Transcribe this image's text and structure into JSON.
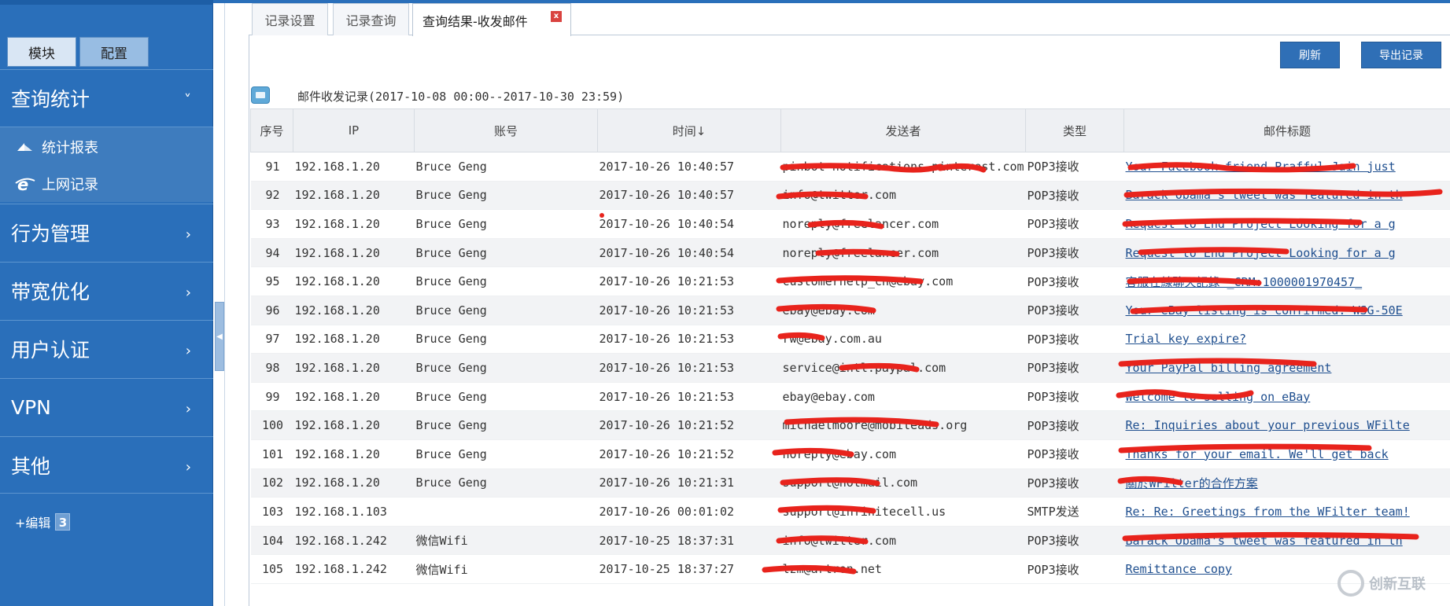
{
  "sidebar": {
    "mode_tabs": {
      "module": "模块",
      "config": "配置"
    },
    "sections": [
      {
        "label": "查询统计",
        "chevron": "˅"
      },
      {
        "label": "行为管理",
        "chevron": "›"
      },
      {
        "label": "带宽优化",
        "chevron": "›"
      },
      {
        "label": "用户认证",
        "chevron": "›"
      },
      {
        "label": "VPN",
        "chevron": "›"
      },
      {
        "label": "其他",
        "chevron": "›"
      }
    ],
    "submenu": [
      {
        "label": "统计报表",
        "icon": "report-icon"
      },
      {
        "label": "上网记录",
        "icon": "ie-icon"
      }
    ],
    "edit": {
      "label": "+编辑",
      "badge": "3"
    }
  },
  "tabs": {
    "record_settings": "记录设置",
    "record_query": "记录查询",
    "result": "查询结果-收发邮件",
    "close": "x"
  },
  "actions": {
    "refresh": "刷新",
    "export": "导出记录"
  },
  "caption": "邮件收发记录(2017-10-08 00:00--2017-10-30 23:59)",
  "table": {
    "headers": [
      "序号",
      "IP",
      "账号",
      "时间↓",
      "发送者",
      "类型",
      "邮件标题"
    ],
    "rows": [
      [
        "91",
        "192.168.1.20",
        "Bruce Geng",
        "2017-10-26 10:40:57",
        "pinbot-notifications.pinterest.com",
        "POP3接收",
        "Your Facebook friend Prafful Jain just"
      ],
      [
        "92",
        "192.168.1.20",
        "Bruce Geng",
        "2017-10-26 10:40:57",
        "info@twitter.com",
        "POP3接收",
        "Barack Obama's tweet was featured in th"
      ],
      [
        "93",
        "192.168.1.20",
        "Bruce Geng",
        "2017-10-26 10:40:54",
        "noreply@freelancer.com",
        "POP3接收",
        "Request to End Project Looking for a g"
      ],
      [
        "94",
        "192.168.1.20",
        "Bruce Geng",
        "2017-10-26 10:40:54",
        "noreply@freelancer.com",
        "POP3接收",
        "Request to End Project Looking for a g"
      ],
      [
        "95",
        "192.168.1.20",
        "Bruce Geng",
        "2017-10-26 10:21:53",
        "customerhelp_cn@ebay.com",
        "POP3接收",
        "客服在線聊天記錄 _CRM:1000001970457_"
      ],
      [
        "96",
        "192.168.1.20",
        "Bruce Geng",
        "2017-10-26 10:21:53",
        "ebay@ebay.com",
        "POP3接收",
        "Your eBay listing is confirmed: WSG-50E"
      ],
      [
        "97",
        "192.168.1.20",
        "Bruce Geng",
        "2017-10-26 10:21:53",
        "rw@ebay.com.au",
        "POP3接收",
        "Trial key expire?"
      ],
      [
        "98",
        "192.168.1.20",
        "Bruce Geng",
        "2017-10-26 10:21:53",
        "service@intl.paypal.com",
        "POP3接收",
        "Your PayPal billing agreement"
      ],
      [
        "99",
        "192.168.1.20",
        "Bruce Geng",
        "2017-10-26 10:21:53",
        "ebay@ebay.com",
        "POP3接收",
        "Welcome to selling on eBay"
      ],
      [
        "100",
        "192.168.1.20",
        "Bruce Geng",
        "2017-10-26 10:21:52",
        "michaelmoore@mobileads.org",
        "POP3接收",
        "Re: Inquiries about your previous WFilte"
      ],
      [
        "101",
        "192.168.1.20",
        "Bruce Geng",
        "2017-10-26 10:21:52",
        "noreply@ebay.com",
        "POP3接收",
        "Thanks for your email. We'll get back"
      ],
      [
        "102",
        "192.168.1.20",
        "Bruce Geng",
        "2017-10-26 10:21:31",
        "support@hotmail.com",
        "POP3接收",
        "關於WFilter的合作方案"
      ],
      [
        "103",
        "192.168.1.103",
        "",
        "2017-10-26 00:01:02",
        "support@infinitecell.us",
        "SMTP发送",
        "Re: Re: Greetings from the WFilter team!"
      ],
      [
        "104",
        "192.168.1.242",
        "微信Wifi",
        "2017-10-25 18:37:31",
        "info@twitter.com",
        "POP3接收",
        "Barack Obama's tweet was featured in th"
      ],
      [
        "105",
        "192.168.1.242",
        "微信Wifi",
        "2017-10-25 18:37:27",
        "lzm@artron.net",
        "POP3接收",
        "Remittance copy"
      ]
    ]
  },
  "watermark": {
    "text": "创新互联"
  },
  "colors": {
    "sidebar": "#2a6fba",
    "button": "#2f6fb6",
    "redaction": "#e8231c",
    "link": "#1f4f8f"
  }
}
